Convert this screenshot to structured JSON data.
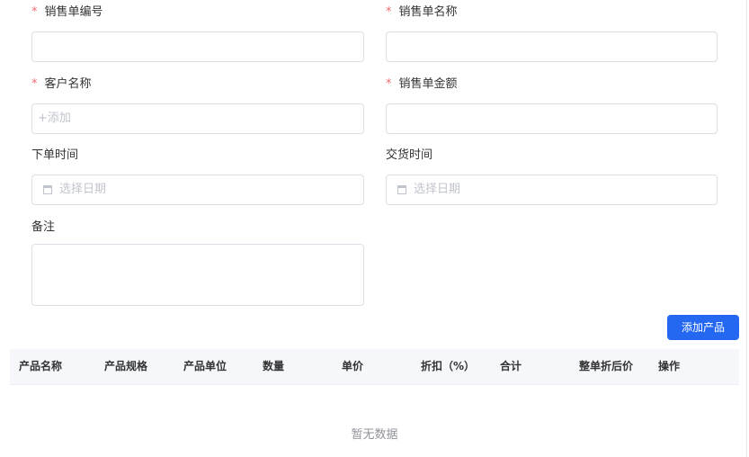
{
  "form": {
    "order_no": {
      "label": "销售单编号",
      "required": "*",
      "value": ""
    },
    "order_name": {
      "label": "销售单名称",
      "required": "*",
      "value": ""
    },
    "customer": {
      "label": "客户名称",
      "required": "*",
      "placeholder": "+添加"
    },
    "amount": {
      "label": "销售单金额",
      "required": "*",
      "value": ""
    },
    "order_time": {
      "label": "下单时间",
      "placeholder": "选择日期"
    },
    "delivery_time": {
      "label": "交货时间",
      "placeholder": "选择日期"
    },
    "remark": {
      "label": "备注",
      "value": ""
    }
  },
  "add_product_button": "添加产品",
  "table": {
    "columns": [
      "产品名称",
      "产品规格",
      "产品单位",
      "数量",
      "单价",
      "折扣（%）",
      "合计",
      "整单折后价",
      "操作"
    ],
    "empty_text": "暂无数据"
  },
  "colors": {
    "primary": "#2468f2",
    "required": "#f56c6c"
  }
}
